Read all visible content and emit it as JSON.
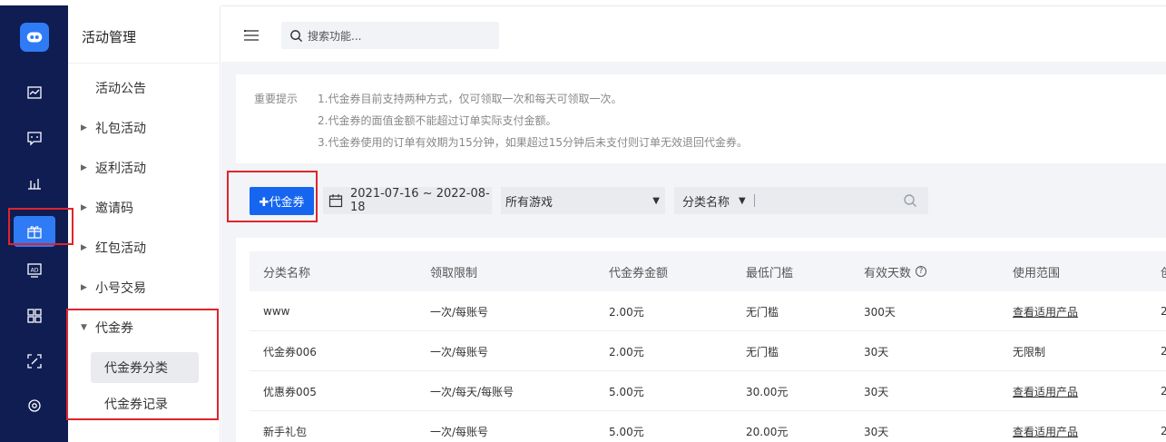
{
  "rail": {
    "icons": [
      "logo-icon",
      "dashboard-icon",
      "message-icon",
      "bar-chart-icon",
      "gift-icon",
      "ad-icon",
      "grid-icon",
      "scan-icon",
      "settings-icon"
    ]
  },
  "subnav": {
    "title": "活动管理",
    "items": [
      {
        "label": "活动公告",
        "arrow": ""
      },
      {
        "label": "礼包活动",
        "arrow": "▶"
      },
      {
        "label": "返利活动",
        "arrow": "▶"
      },
      {
        "label": "邀请码",
        "arrow": "▶"
      },
      {
        "label": "红包活动",
        "arrow": "▶"
      },
      {
        "label": "小号交易",
        "arrow": "▶"
      },
      {
        "label": "代金券",
        "arrow": "▼"
      }
    ],
    "sub_items": [
      {
        "label": "代金券分类",
        "active": true
      },
      {
        "label": "代金券记录",
        "active": false
      }
    ]
  },
  "header": {
    "search_placeholder": "搜索功能..."
  },
  "notice": {
    "title": "重要提示",
    "lines": [
      "1.代金券目前支持两种方式，仅可领取一次和每天可领取一次。",
      "2.代金券的面值金额不能超过订单实际支付金额。",
      "3.代金券使用的订单有效期为15分钟，如果超过15分钟后未支付则订单无效退回代金券。"
    ]
  },
  "toolbar": {
    "add_button": "✚代金券",
    "date_range": "2021-07-16 ~ 2022-08-18",
    "game_select": "所有游戏",
    "filter_type": "分类名称",
    "caret": "▼"
  },
  "table": {
    "headers": [
      "分类名称",
      "领取限制",
      "代金券金额",
      "最低门槛",
      "有效天数",
      "使用范围",
      "创"
    ],
    "help_mark": "?",
    "rows": [
      [
        "www",
        "一次/每账号",
        "2.00元",
        "无门槛",
        "300天",
        "查看适用产品",
        "2"
      ],
      [
        "代金券006",
        "一次/每账号",
        "2.00元",
        "无门槛",
        "30天",
        "无限制",
        "2"
      ],
      [
        "优惠券005",
        "一次/每天/每账号",
        "5.00元",
        "30.00元",
        "30天",
        "查看适用产品",
        "2"
      ],
      [
        "新手礼包",
        "一次/每账号",
        "5.00元",
        "20.00元",
        "30天",
        "查看适用产品",
        "2"
      ]
    ]
  },
  "colors": {
    "rail_bg": "#0f1d52",
    "accent": "#1565f0",
    "annotation_red": "#e0242c"
  }
}
